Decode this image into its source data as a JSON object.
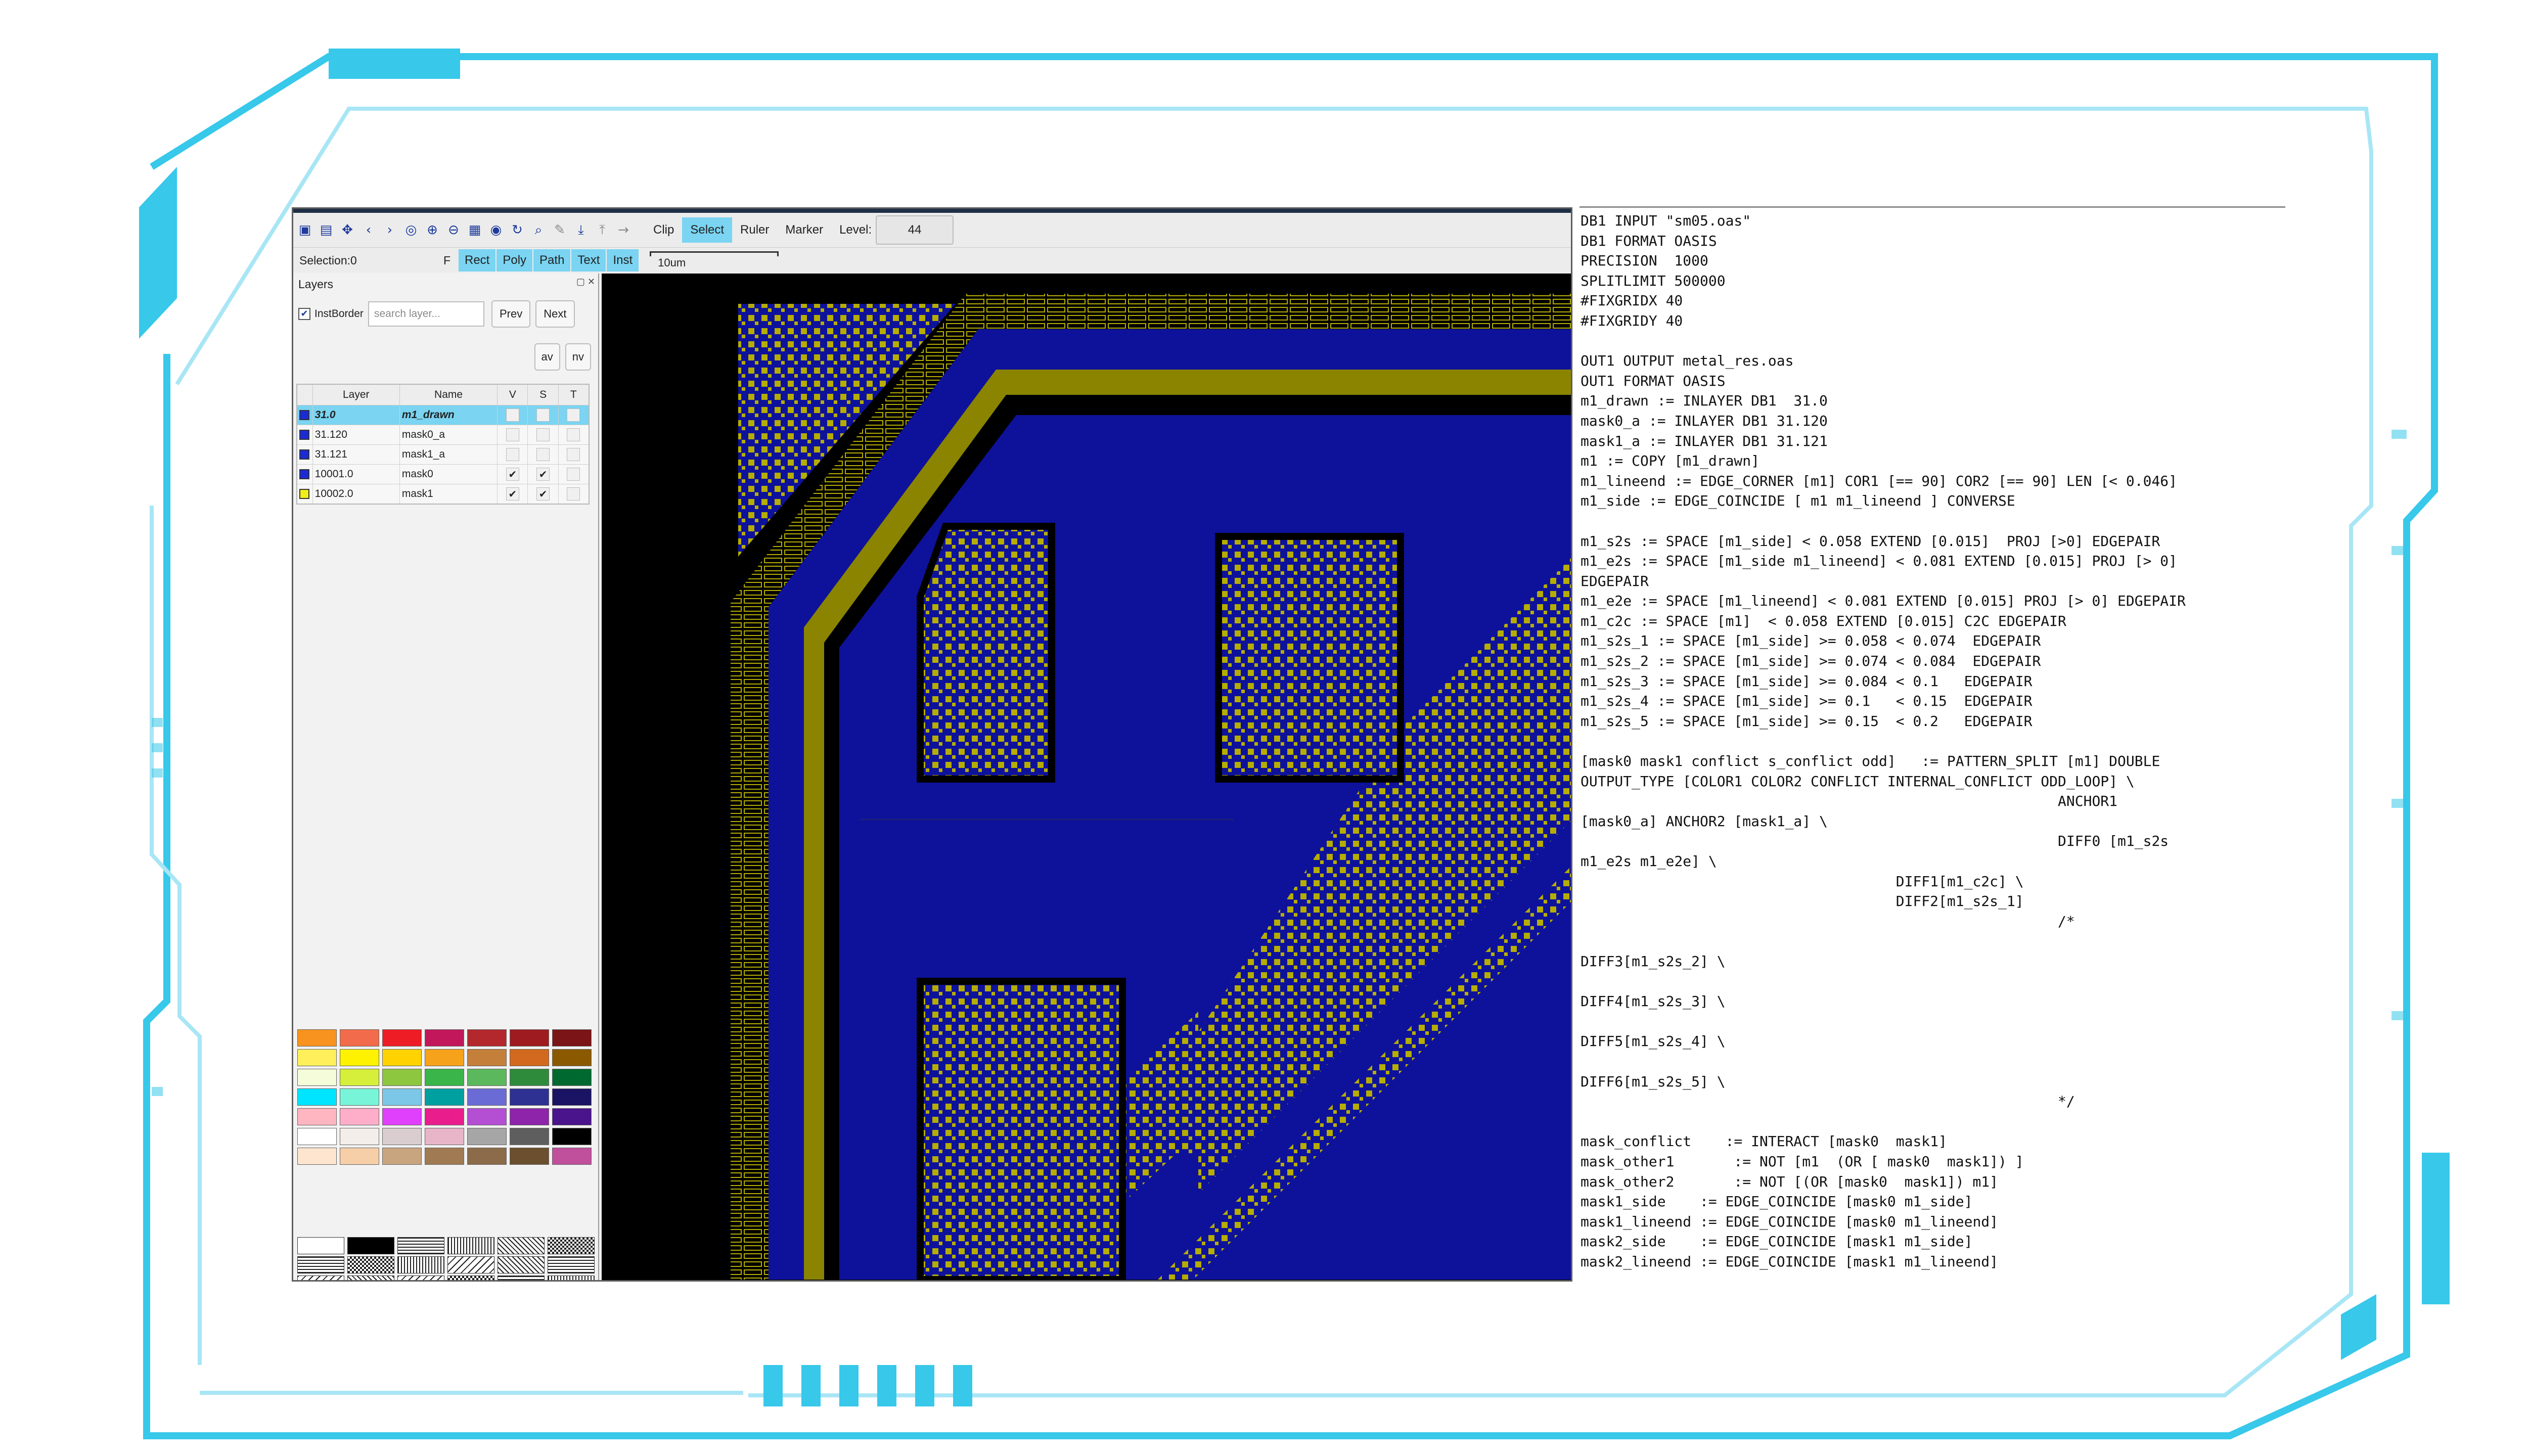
{
  "colors": {
    "frame_cyan": "#37c8ea",
    "frame_light": "#a8e6f5",
    "active_blue": "#7ad4f2",
    "metal_blue": "#0e129a",
    "metal_yellow": "#b5ad00",
    "canvas_bg": "#000000"
  },
  "toolbar": {
    "icons": [
      "save-icon",
      "open-icon",
      "move-icon",
      "back-icon",
      "forward-icon",
      "zoom-fit-icon",
      "zoom-in-icon",
      "zoom-out-icon",
      "grid-icon",
      "eye-icon",
      "refresh-icon",
      "search-icon",
      "pencil-icon",
      "anchor-down-icon",
      "anchor-up-icon",
      "arrow-right-icon"
    ],
    "icon_glyphs": [
      "▣",
      "▤",
      "✥",
      "‹",
      "›",
      "◎",
      "⊕",
      "⊖",
      "▦",
      "◉",
      "↻",
      "⌕",
      "✎",
      "⤓",
      "⤒",
      "→"
    ],
    "clip_label": "Clip",
    "select_label": "Select",
    "ruler_label": "Ruler",
    "marker_label": "Marker",
    "level_label": "Level:",
    "level_value": "44"
  },
  "toolbar2": {
    "selection_label": "Selection:0",
    "f_label": "F",
    "shape_buttons": [
      "Rect",
      "Poly",
      "Path",
      "Text",
      "Inst"
    ],
    "scale_label": "10um"
  },
  "layers_panel": {
    "title": "Layers",
    "instborder_label": "InstBorder",
    "instborder_checked": true,
    "search_placeholder": "search layer...",
    "prev_label": "Prev",
    "next_label": "Next",
    "av_label": "av",
    "nv_label": "nv",
    "columns": [
      "Layer",
      "Name",
      "V",
      "S",
      "T"
    ],
    "rows": [
      {
        "layer": "31.0",
        "name": "m1_drawn",
        "color": "#1a2bd6",
        "v": "",
        "s": "",
        "t": "",
        "selected": true
      },
      {
        "layer": "31.120",
        "name": "mask0_a",
        "color": "#1a2bd6",
        "v": "",
        "s": "",
        "t": "",
        "selected": false
      },
      {
        "layer": "31.121",
        "name": "mask1_a",
        "color": "#1a2bd6",
        "v": "",
        "s": "",
        "t": "",
        "selected": false
      },
      {
        "layer": "10001.0",
        "name": "mask0",
        "color": "#1a2bd6",
        "v": "✔",
        "s": "✔",
        "t": "",
        "selected": false
      },
      {
        "layer": "10002.0",
        "name": "mask1",
        "color": "#f2ec1a",
        "v": "✔",
        "s": "✔",
        "t": "",
        "selected": false
      }
    ],
    "palette": [
      [
        "#f7931e",
        "#f26b4a",
        "#ee1c24",
        "#c2185b",
        "#b3282d",
        "#9e1b20",
        "#7b1416"
      ],
      [
        "#ffef5a",
        "#fff200",
        "#ffd200",
        "#f7a21b",
        "#c47f3a",
        "#d2691e",
        "#8b5a00"
      ],
      [
        "#f4fcd9",
        "#d6ef3a",
        "#8dc63f",
        "#39b54a",
        "#5cb85c",
        "#2e8b3c",
        "#00692f"
      ],
      [
        "#00e5ff",
        "#78f5d9",
        "#7cc7e8",
        "#00a0a0",
        "#6b6bd6",
        "#2e3192",
        "#1b1464"
      ],
      [
        "#ffb6c1",
        "#ffaec9",
        "#e040fb",
        "#e91e8c",
        "#b44fd4",
        "#8e24aa",
        "#4a148c"
      ],
      [
        "#ffffff",
        "#f3eeea",
        "#d9cdd0",
        "#e8b4c8",
        "#a6a6a6",
        "#5e5e5e",
        "#000000"
      ],
      [
        "#fde5cf",
        "#f6cfa8",
        "#c9a57f",
        "#a07a52",
        "#8b6b4a",
        "#6b4f2e",
        "#c04f9c"
      ]
    ]
  },
  "code": {
    "lines": [
      "DB1 INPUT \"sm05.oas\"",
      "DB1 FORMAT OASIS",
      "PRECISION  1000",
      "SPLITLIMIT 500000",
      "#FIXGRIDX 40",
      "#FIXGRIDY 40",
      "",
      "OUT1 OUTPUT metal_res.oas",
      "OUT1 FORMAT OASIS",
      "m1_drawn := INLAYER DB1  31.0",
      "mask0_a := INLAYER DB1 31.120",
      "mask1_a := INLAYER DB1 31.121",
      "m1 := COPY [m1_drawn]",
      "m1_lineend := EDGE_CORNER [m1] COR1 [== 90] COR2 [== 90] LEN [< 0.046]",
      "m1_side := EDGE_COINCIDE [ m1 m1_lineend ] CONVERSE",
      "",
      "m1_s2s := SPACE [m1_side] < 0.058 EXTEND [0.015]  PROJ [>0] EDGEPAIR",
      "m1_e2s := SPACE [m1_side m1_lineend] < 0.081 EXTEND [0.015] PROJ [> 0]",
      "EDGEPAIR",
      "m1_e2e := SPACE [m1_lineend] < 0.081 EXTEND [0.015] PROJ [> 0] EDGEPAIR",
      "m1_c2c := SPACE [m1]  < 0.058 EXTEND [0.015] C2C EDGEPAIR",
      "m1_s2s_1 := SPACE [m1_side] >= 0.058 < 0.074  EDGEPAIR",
      "m1_s2s_2 := SPACE [m1_side] >= 0.074 < 0.084  EDGEPAIR",
      "m1_s2s_3 := SPACE [m1_side] >= 0.084 < 0.1   EDGEPAIR",
      "m1_s2s_4 := SPACE [m1_side] >= 0.1   < 0.15  EDGEPAIR",
      "m1_s2s_5 := SPACE [m1_side] >= 0.15  < 0.2   EDGEPAIR",
      "",
      "[mask0 mask1 conflict s_conflict odd]   := PATTERN_SPLIT [m1] DOUBLE",
      "OUTPUT_TYPE [COLOR1 COLOR2 CONFLICT INTERNAL_CONFLICT ODD_LOOP] \\",
      "                                                        ANCHOR1",
      "[mask0_a] ANCHOR2 [mask1_a] \\",
      "                                                        DIFF0 [m1_s2s",
      "m1_e2s m1_e2e] \\",
      "                                     DIFF1[m1_c2c] \\",
      "                                     DIFF2[m1_s2s_1]",
      "                                                        /*",
      "",
      "DIFF3[m1_s2s_2] \\",
      "",
      "DIFF4[m1_s2s_3] \\",
      "",
      "DIFF5[m1_s2s_4] \\",
      "",
      "DIFF6[m1_s2s_5] \\",
      "                                                        */",
      "",
      "mask_conflict    := INTERACT [mask0  mask1]",
      "mask_other1       := NOT [m1  (OR [ mask0  mask1]) ]",
      "mask_other2       := NOT [(OR [mask0  mask1]) m1]",
      "mask1_side    := EDGE_COINCIDE [mask0 m1_side]",
      "mask1_lineend := EDGE_COINCIDE [mask0 m1_lineend]",
      "mask2_side    := EDGE_COINCIDE [mask1 m1_side]",
      "mask2_lineend := EDGE_COINCIDE [mask1 m1_lineend]"
    ]
  }
}
